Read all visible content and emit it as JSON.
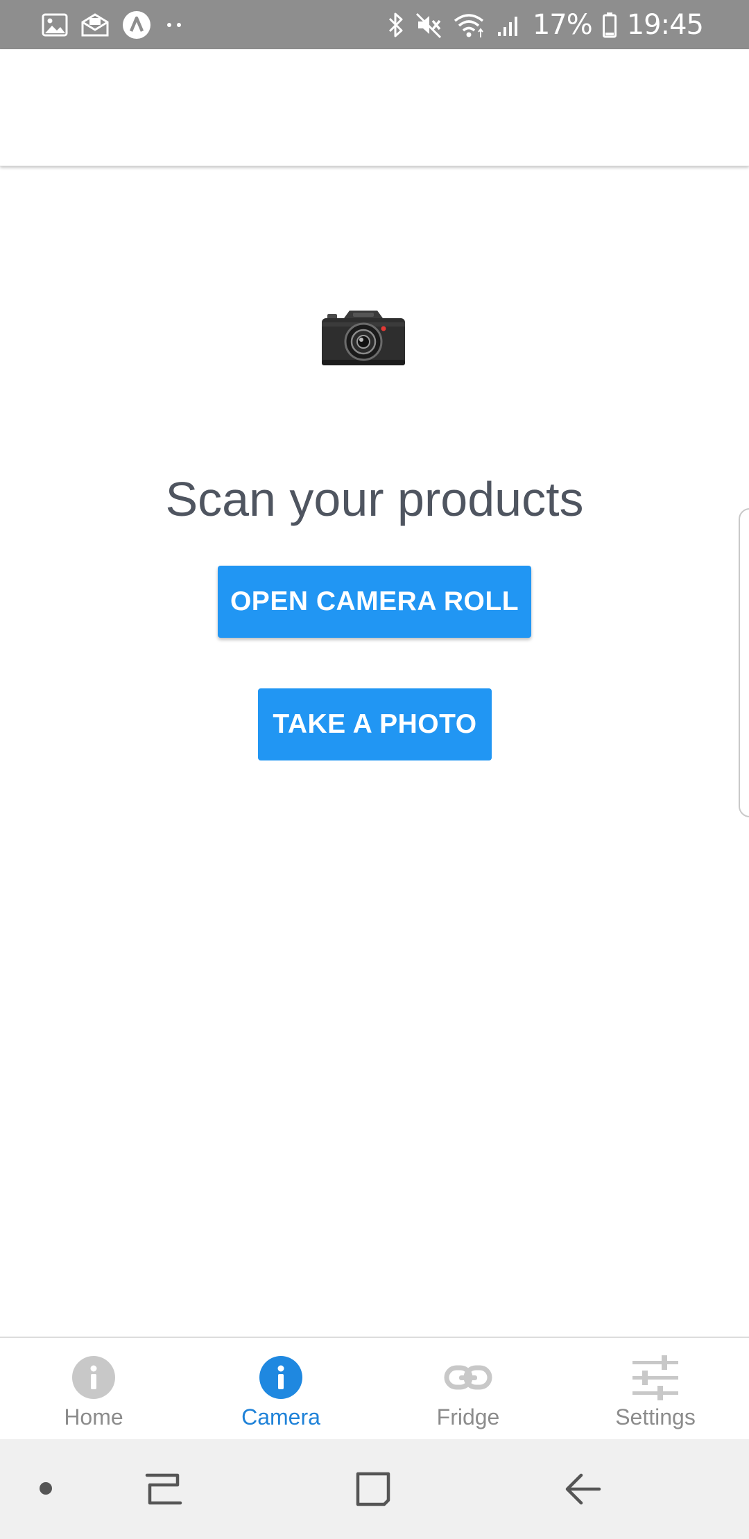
{
  "status_bar": {
    "battery_percent": "17%",
    "time": "19:45",
    "left_icons": [
      "gallery-icon",
      "mail-icon",
      "app-a-icon",
      "more-notifications-icon"
    ],
    "right_icons": [
      "bluetooth-icon",
      "mute-icon",
      "wifi-icon",
      "signal-icon",
      "battery-icon"
    ]
  },
  "main": {
    "hero_icon": "camera-icon",
    "headline": "Scan your products",
    "open_camera_roll_label": "OPEN CAMERA ROLL",
    "take_photo_label": "TAKE A PHOTO"
  },
  "tabs": [
    {
      "label": "Home",
      "icon": "info-icon",
      "active": false
    },
    {
      "label": "Camera",
      "icon": "info-icon",
      "active": true
    },
    {
      "label": "Fridge",
      "icon": "link-icon",
      "active": false
    },
    {
      "label": "Settings",
      "icon": "sliders-icon",
      "active": false
    }
  ],
  "nav_bar": {
    "items": [
      "dot-icon",
      "recents-icon",
      "home-square-icon",
      "back-arrow-icon"
    ]
  },
  "colors": {
    "accent": "#2196f3",
    "active_tab": "#1f82d8",
    "inactive_tab": "#8c8c8c",
    "headline": "#4f5560",
    "status_bar": "#8e8e8e",
    "nav_bar": "#f0f0f0"
  }
}
